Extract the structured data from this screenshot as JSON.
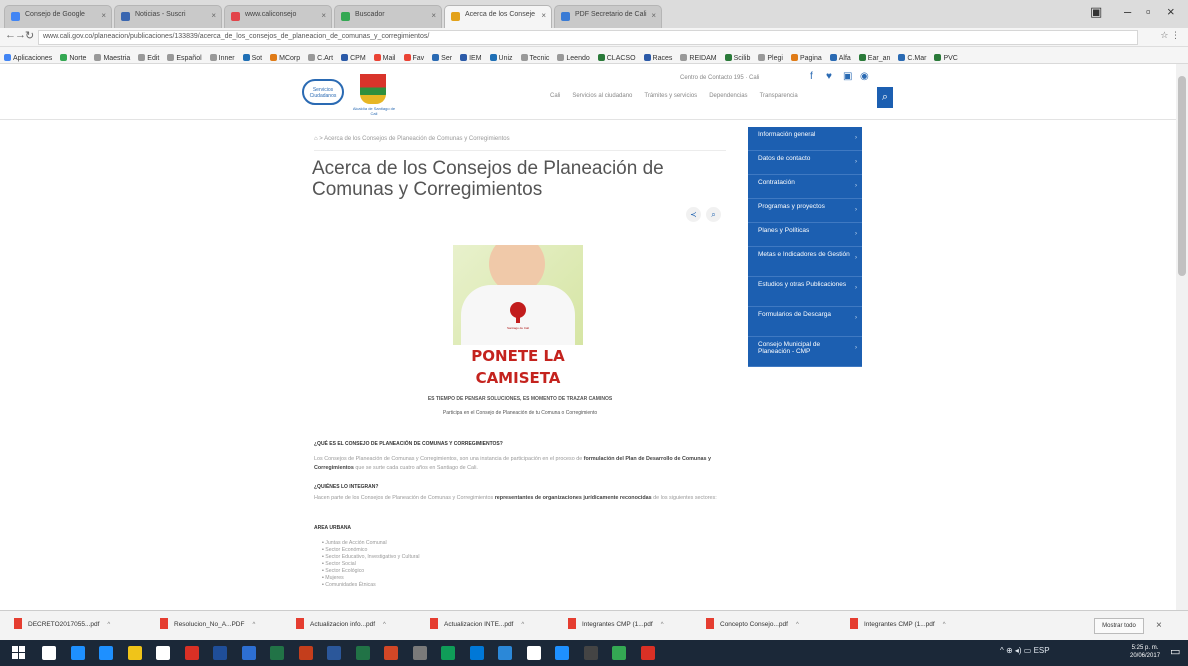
{
  "browser": {
    "tabs": [
      {
        "label": "Consejo de Google",
        "color": "#4285f4"
      },
      {
        "label": "Noticias - Suscri",
        "color": "#3a66b0"
      },
      {
        "label": "www.caliconsejo",
        "color": "#e2444a"
      },
      {
        "label": "Buscador",
        "color": "#34a853"
      },
      {
        "label": "Acerca de los Conseje",
        "color": "#e3a21a"
      },
      {
        "label": "PDF Secretario de Cali",
        "color": "#3a7bd5"
      }
    ],
    "url": "www.cali.gov.co/planeacion/publicaciones/133839/acerca_de_los_consejos_de_planeacion_de_comunas_y_corregimientos/",
    "bookmarks": [
      {
        "label": "Aplicaciones",
        "color": "#4285f4"
      },
      {
        "label": "Norte",
        "color": "#34a853"
      },
      {
        "label": "Maestria",
        "color": "#999999"
      },
      {
        "label": "Edit",
        "color": "#999999"
      },
      {
        "label": "Español",
        "color": "#999999"
      },
      {
        "label": "Inner",
        "color": "#999999"
      },
      {
        "label": "Sot",
        "color": "#1f6fb5"
      },
      {
        "label": "MCorp",
        "color": "#e07b17"
      },
      {
        "label": "C.Art",
        "color": "#999999"
      },
      {
        "label": "CPM",
        "color": "#2b5aa8"
      },
      {
        "label": "Mail",
        "color": "#ea4335"
      },
      {
        "label": "Fav",
        "color": "#ea4335"
      },
      {
        "label": "Ser",
        "color": "#2a6ab3"
      },
      {
        "label": "IEM",
        "color": "#2b5aa8"
      },
      {
        "label": "Uniz",
        "color": "#1f6fb5"
      },
      {
        "label": "Tecnic",
        "color": "#999999"
      },
      {
        "label": "Leendo",
        "color": "#999999"
      },
      {
        "label": "CLACSO",
        "color": "#2a7a39"
      },
      {
        "label": "Races",
        "color": "#2b5aa8"
      },
      {
        "label": "REIDAM",
        "color": "#999999"
      },
      {
        "label": "Scilib",
        "color": "#2a7a39"
      },
      {
        "label": "Plegi",
        "color": "#999999"
      },
      {
        "label": "Pagina",
        "color": "#e07b17"
      },
      {
        "label": "Alfa",
        "color": "#2a6ab3"
      },
      {
        "label": "Ear_an",
        "color": "#2a7a39"
      },
      {
        "label": "C.Mar",
        "color": "#2a6ab3"
      },
      {
        "label": "PVC",
        "color": "#2a7a39"
      }
    ]
  },
  "header": {
    "cloud_logo_text": "Servicios Ciudadanos",
    "crest_label": "Alcaldía de Santiago de Cali",
    "top_links": "Centro de Contacto 195 · Cali",
    "menu": [
      "Cali",
      "Servicios al ciudadano",
      "Trámites y servicios",
      "Dependencias",
      "Transparencia"
    ]
  },
  "content": {
    "breadcrumb": "Acerca de los Consejos de Planeación de Comunas y Corregimientos",
    "title": "Acerca de los Consejos de Planeación de Comunas y Corregimientos",
    "hero_caption": "Santiago de Cali",
    "campaign_line1": "PONETE LA",
    "campaign_line2": "CAMISETA",
    "subtitle1": "ES TIEMPO DE PENSAR SOLUCIONES, ES MOMENTO DE TRAZAR CAMINOS",
    "subtitle2": "Participa en el Consejo de Planeación de tu Comuna o Corregimiento",
    "q1": "¿QUÉ ES EL CONSEJO DE PLANEACIÓN DE COMUNAS Y CORREGIMIENTOS?",
    "p1_a": "Los Consejos de Planeación de Comunas y Corregimientos, son una instancia de participación en el proceso de ",
    "p1_b": "formulación del Plan de Desarrollo de Comunas y Corregimientos",
    "p1_c": " que se surte cada cuatro años en Santiago de Cali.",
    "q2": "¿QUIÉNES LO INTEGRAN?",
    "p2_a": "Hacen parte de los Consejos de Planeación de Comunas y Corregimientos ",
    "p2_b": "representantes de organizaciones jurídicamente reconocidas",
    "p2_c": " de los siguientes sectores:",
    "areas_heading": "AREA URBANA",
    "areas": [
      "Juntas de Acción Comunal",
      "Sector Económico",
      "Sector Educativo, Investigativo y Cultural",
      "Sector Social",
      "Sector Ecológico",
      "Mujeres",
      "Comunidades Étnicas"
    ]
  },
  "side_menu": [
    {
      "label": "Información general"
    },
    {
      "label": "Datos de contacto"
    },
    {
      "label": "Contratación"
    },
    {
      "label": "Programas y proyectos"
    },
    {
      "label": "Planes y Políticas"
    },
    {
      "label": "Metas e Indicadores de Gestión"
    },
    {
      "label": "Estudios y otras Publicaciones"
    },
    {
      "label": "Formularios de Descarga"
    },
    {
      "label": "Consejo Municipal de Planeación - CMP"
    }
  ],
  "downloads": [
    {
      "label": "DECRETO2017055...pdf"
    },
    {
      "label": "Resolucion_No_A...PDF"
    },
    {
      "label": "Actualizacion info...pdf"
    },
    {
      "label": "Actualizacion INTE...pdf"
    },
    {
      "label": "Integrantes CMP (1...pdf"
    },
    {
      "label": "Concepto Consejo...pdf"
    },
    {
      "label": "Integrantes CMP (1...pdf"
    }
  ],
  "show_all_label": "Mostrar todo",
  "taskbar": {
    "apps": [
      {
        "color": "#ffffff"
      },
      {
        "color": "#1e90ff"
      },
      {
        "color": "#1e90ff"
      },
      {
        "color": "#f0c419"
      },
      {
        "color": "#ffffff"
      },
      {
        "color": "#d93025"
      },
      {
        "color": "#1f4e99"
      },
      {
        "color": "#2d6fd2"
      },
      {
        "color": "#217346"
      },
      {
        "color": "#c43e1c"
      },
      {
        "color": "#2b579a"
      },
      {
        "color": "#217346"
      },
      {
        "color": "#d24726"
      },
      {
        "color": "#7a7a7a"
      },
      {
        "color": "#0f9d58"
      },
      {
        "color": "#0078d7"
      },
      {
        "color": "#2b88d8"
      },
      {
        "color": "#ffffff"
      },
      {
        "color": "#1e90ff"
      },
      {
        "color": "#444444"
      },
      {
        "color": "#34a853"
      },
      {
        "color": "#d93025"
      }
    ],
    "tray_text": "^ ⊕ ◂) ▭ ESP",
    "time": "5:25 p. m.",
    "date": "20/06/2017"
  }
}
